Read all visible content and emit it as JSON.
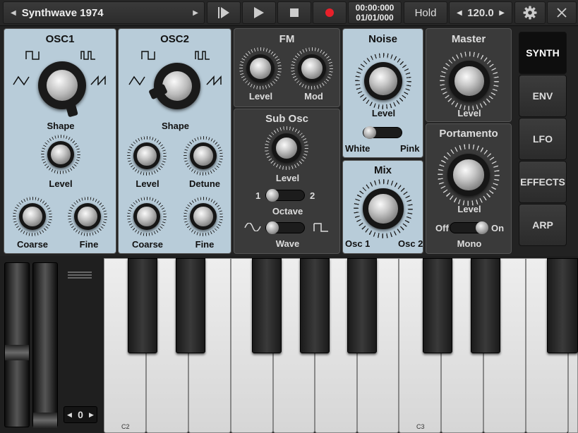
{
  "topbar": {
    "preset_name": "Synthwave 1974",
    "time_top": "00:00:000",
    "time_bottom": "01/01/000",
    "hold_label": "Hold",
    "tempo": "120.0",
    "icons": [
      "prev-arrow-icon",
      "next-arrow-icon",
      "skip-to-start-icon",
      "play-icon",
      "stop-icon",
      "record-icon",
      "tempo-down-icon",
      "tempo-up-icon",
      "gear-icon",
      "close-icon"
    ]
  },
  "osc1": {
    "title": "OSC1",
    "shape_label": "Shape",
    "level_label": "Level",
    "coarse_label": "Coarse",
    "fine_label": "Fine"
  },
  "osc2": {
    "title": "OSC2",
    "shape_label": "Shape",
    "level_label": "Level",
    "detune_label": "Detune",
    "coarse_label": "Coarse",
    "fine_label": "Fine"
  },
  "fm": {
    "title": "FM",
    "level_label": "Level",
    "mod_label": "Mod"
  },
  "sub_osc": {
    "title": "Sub Osc",
    "level_label": "Level",
    "octave_min": "1",
    "octave_max": "2",
    "octave_label": "Octave",
    "wave_label": "Wave"
  },
  "noise": {
    "title": "Noise",
    "level_label": "Level",
    "white_label": "White",
    "pink_label": "Pink"
  },
  "mix": {
    "title": "Mix",
    "osc1_label": "Osc 1",
    "osc2_label": "Osc 2"
  },
  "master": {
    "title": "Master",
    "level_label": "Level"
  },
  "portamento": {
    "title": "Portamento",
    "level_label": "Level",
    "off_label": "Off",
    "on_label": "On",
    "mono_label": "Mono"
  },
  "tabs": [
    {
      "label": "SYNTH",
      "active": true
    },
    {
      "label": "ENV",
      "active": false
    },
    {
      "label": "LFO",
      "active": false
    },
    {
      "label": "EFFECTS",
      "active": false
    },
    {
      "label": "ARP",
      "active": false
    }
  ],
  "keyboard": {
    "octave_value": "0",
    "key_labels": {
      "c2": "C2",
      "c3": "C3"
    }
  },
  "colors": {
    "light_panel": "#b8ccd9",
    "dark_panel": "#3a3a3a",
    "record": "#e8202a"
  }
}
